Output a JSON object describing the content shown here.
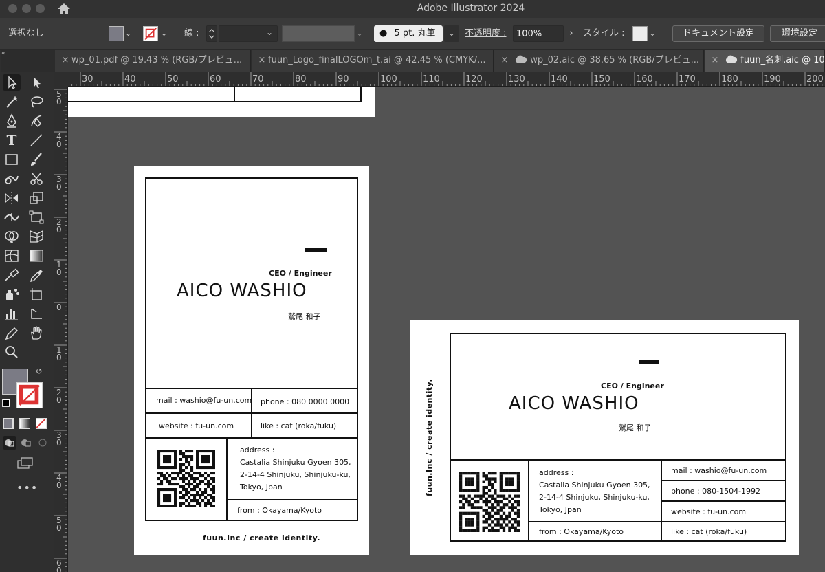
{
  "app": {
    "title": "Adobe Illustrator 2024"
  },
  "control_bar": {
    "selection": "選択なし",
    "stroke_label": "線 :",
    "brush": "5 pt. 丸筆",
    "opacity_label": "不透明度 :",
    "opacity_value": "100%",
    "style_label": "スタイル :",
    "doc_settings": "ドキュメント設定",
    "preferences": "環境設定"
  },
  "tabs": [
    {
      "label": "wp_01.pdf @ 19.43 % (RGB/プレビュ..."
    },
    {
      "label": "fuun_Logo_finalLOGOm_t.ai @ 42.45 % (CMYK/..."
    },
    {
      "label": "wp_02.aic @ 38.65 % (RGB/プレビュ..."
    },
    {
      "label": "fuun_名刺.aic @ 106"
    }
  ],
  "ruler_top": [
    "30",
    "40",
    "50",
    "60",
    "70",
    "80",
    "90",
    "100",
    "110",
    "120",
    "130",
    "140",
    "150",
    "160",
    "170",
    "180",
    "190",
    "200"
  ],
  "ruler_left": [
    "5 0",
    "4 0",
    "3 0",
    "2 0",
    "1 0",
    "0",
    "1 0",
    "2 0",
    "3 0",
    "4 0",
    "5 0",
    "6 0"
  ],
  "cards": {
    "vertical": {
      "role": "CEO / Engineer",
      "name": "AICO WASHIO",
      "name_jp": "鷲尾 和子",
      "mail": "mail : washio@fu-un.com",
      "phone": "phone : 080 0000 0000",
      "website": "website : fu-un.com",
      "like": "like : cat (roka/fuku)",
      "address_label": "address :",
      "address_1": "Castalia Shinjuku Gyoen 305,",
      "address_2": "2-14-4 Shinjuku, Shinjuku-ku,",
      "address_3": "Tokyo, Jpan",
      "from": "from : Okayama/Kyoto",
      "footer": "fuun.Inc / create identity."
    },
    "horizontal": {
      "role": "CEO / Engineer",
      "name": "AICO WASHIO",
      "name_jp": "鷲尾 和子",
      "side": "fuun.Inc / create identity.",
      "address_label": "address :",
      "address_1": "Castalia Shinjuku Gyoen 305,",
      "address_2": "2-14-4 Shinjuku, Shinjuku-ku,",
      "address_3": "Tokyo, Jpan",
      "mail": "mail : washio@fu-un.com",
      "phone": "phone : 080-1504-1992",
      "website": "website : fu-un.com",
      "from": "from : Okayama/Kyoto",
      "like": "like : cat (roka/fuku)"
    }
  },
  "colors": {
    "fill_swatch": "#7b7b85",
    "stroke_swatch": "#ffffff",
    "panel": "#2f2f2f",
    "canvas": "#535353"
  },
  "icons": [
    "home-icon",
    "selection-tool-icon",
    "direct-selection-icon",
    "magic-wand-icon",
    "lasso-icon",
    "pen-icon",
    "curvature-icon",
    "type-tool-icon",
    "line-tool-icon",
    "rectangle-tool-icon",
    "paintbrush-icon",
    "shaper-icon",
    "scissors-icon",
    "reflect-icon",
    "scale-icon",
    "width-tool-icon",
    "free-transform-icon",
    "shape-builder-icon",
    "perspective-grid-icon",
    "mesh-icon",
    "gradient-icon",
    "eyedropper-icon",
    "blend-icon",
    "symbol-sprayer-icon",
    "artboard-icon",
    "column-graph-icon",
    "slice-icon",
    "hand-icon",
    "zoom-icon",
    "more-tools-icon"
  ]
}
